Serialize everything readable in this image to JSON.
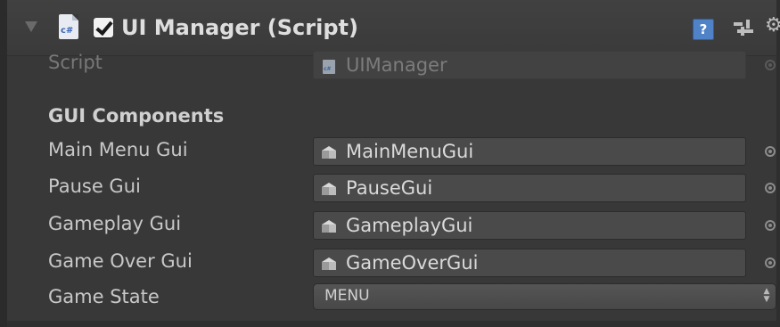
{
  "component": {
    "title": "UI Manager (Script)",
    "enabled": true,
    "cs_icon_text": "c#",
    "help_icon_text": "?",
    "icons": {
      "foldout": "foldout-arrow-icon",
      "script": "csharp-script-icon",
      "help": "help-icon",
      "presets": "preset-sliders-icon",
      "settings": "gear-icon"
    }
  },
  "script_row": {
    "label": "Script",
    "value": "UIManager",
    "small_icon_text": "c#"
  },
  "section": {
    "label": "GUI Components"
  },
  "fields": [
    {
      "label": "Main Menu Gui",
      "value": "MainMenuGui"
    },
    {
      "label": "Pause Gui",
      "value": "PauseGui"
    },
    {
      "label": "Gameplay Gui",
      "value": "GameplayGui"
    },
    {
      "label": "Game Over Gui",
      "value": "GameOverGui"
    }
  ],
  "game_state": {
    "label": "Game State",
    "value": "MENU"
  },
  "colors": {
    "panel_background": "#383838",
    "field_background": "#4a4a4a",
    "help_icon": "#4f82c6"
  }
}
